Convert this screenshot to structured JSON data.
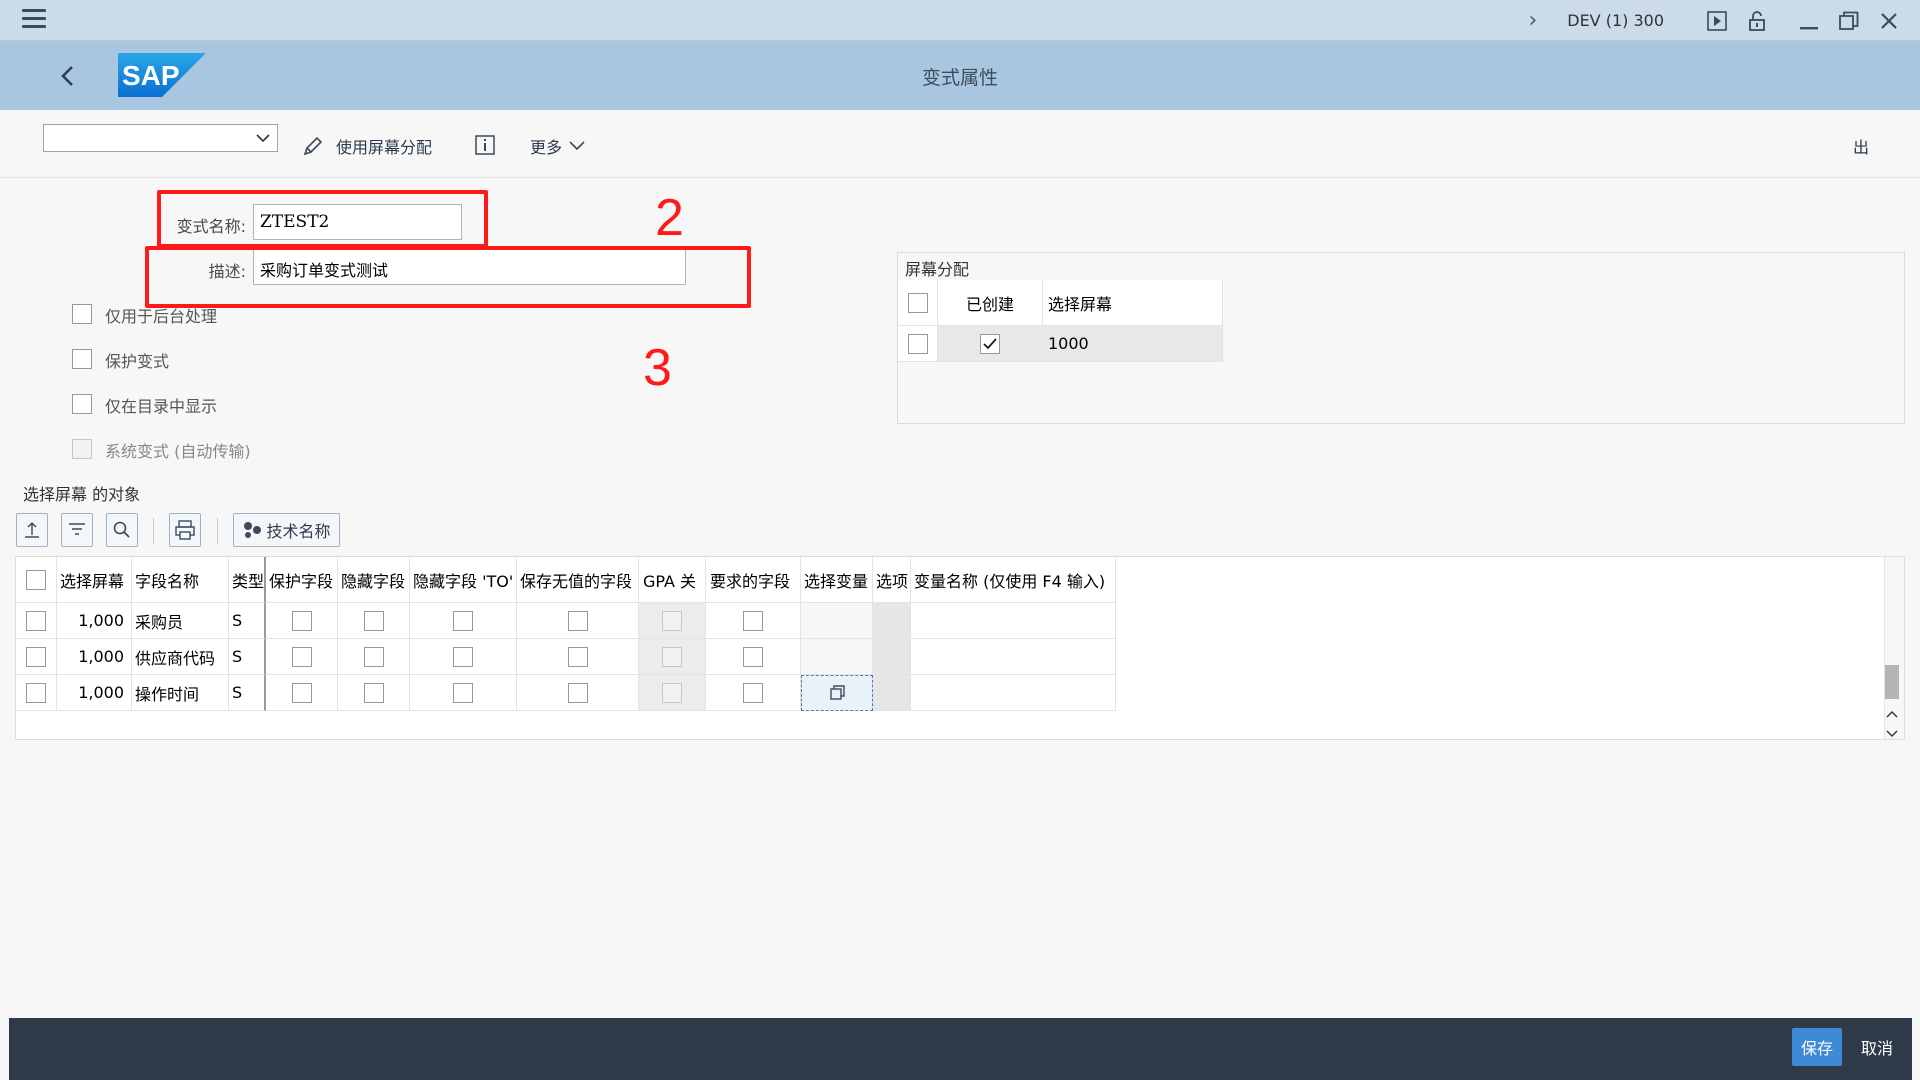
{
  "system": {
    "name": "DEV (1) 300"
  },
  "shell": {
    "title": "变式属性",
    "logo_text": "SAP"
  },
  "toolbar": {
    "dropdown_value": "",
    "use_screen_assign": "使用屏幕分配",
    "more": "更多",
    "exit": "出"
  },
  "form": {
    "variant_name_label": "变式名称:",
    "variant_name_value": "ZTEST2",
    "description_label": "描述:",
    "description_value": "采购订单变式测试",
    "checkboxes": [
      {
        "label": "仅用于后台处理",
        "checked": false,
        "disabled": false
      },
      {
        "label": "保护变式",
        "checked": false,
        "disabled": false
      },
      {
        "label": "仅在目录中显示",
        "checked": false,
        "disabled": false
      },
      {
        "label": "系统变式 (自动传输)",
        "checked": false,
        "disabled": true
      }
    ],
    "annotations": [
      "2",
      "3"
    ]
  },
  "screen_assign": {
    "title": "屏幕分配",
    "columns": [
      "已创建",
      "选择屏幕"
    ],
    "rows": [
      {
        "created": true,
        "screen": "1000"
      }
    ]
  },
  "objects": {
    "title": "选择屏幕   的对象",
    "tech_name_button": "技术名称",
    "columns": [
      "选择屏幕",
      "字段名称",
      "类型",
      "保护字段",
      "隐藏字段",
      "隐藏字段 'TO'",
      "保存无值的字段",
      "GPA 关",
      "要求的字段",
      "选择变量",
      "选项",
      "变量名称 (仅使用 F4 输入)"
    ],
    "rows": [
      {
        "screen": "1,000",
        "field": "采购员",
        "type": "S"
      },
      {
        "screen": "1,000",
        "field": "供应商代码",
        "type": "S"
      },
      {
        "screen": "1,000",
        "field": "操作时间",
        "type": "S"
      }
    ]
  },
  "footer": {
    "save": "保存",
    "cancel": "取消"
  }
}
